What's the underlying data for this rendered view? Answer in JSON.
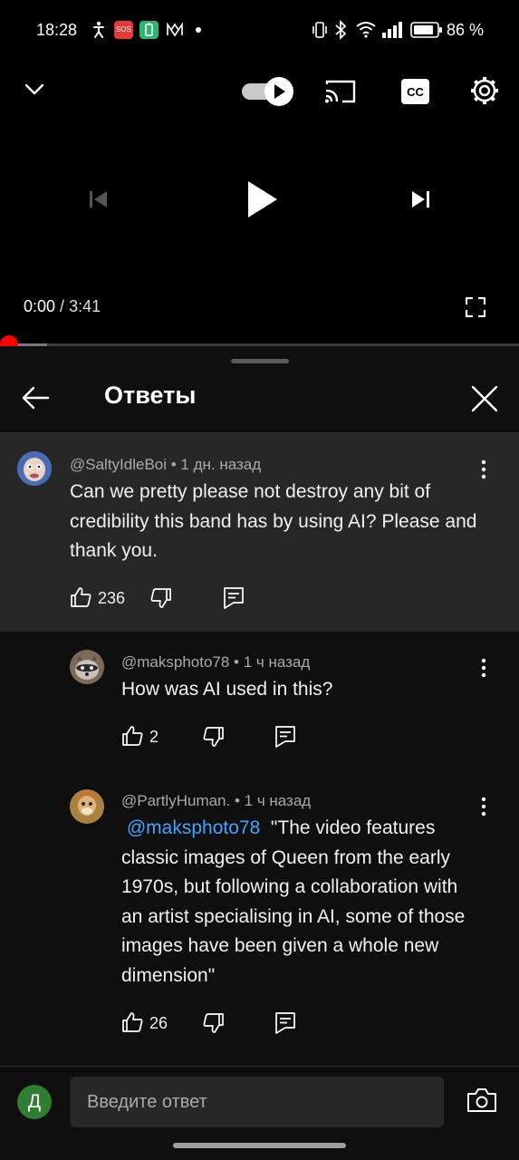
{
  "status_bar": {
    "time": "18:28",
    "battery": "86 %",
    "left_icons": [
      "accessibility-icon",
      "sos-icon",
      "battery-saver-icon",
      "network-icon",
      "dot-icon"
    ],
    "right_icons": [
      "vibrate-icon",
      "bluetooth-icon",
      "wifi-icon",
      "signal-icon",
      "battery-icon"
    ]
  },
  "player": {
    "current_time": "0:00",
    "separator": " / ",
    "duration": "3:41",
    "progress_fraction": 0.0,
    "autoplay_on": true,
    "controls": [
      "collapse-icon",
      "autoplay-toggle",
      "cast-icon",
      "captions-icon",
      "settings-icon",
      "previous-icon",
      "play-icon",
      "next-icon",
      "fullscreen-icon"
    ]
  },
  "panel": {
    "title": "Ответы"
  },
  "comments": [
    {
      "author": "@SaltyIdleBoi",
      "meta": " • 1 дн. назад",
      "text": "Can we pretty please not destroy any bit of credibility this band has by using AI? Please and thank you.",
      "likes": "236",
      "highlighted": true
    },
    {
      "author": "@maksphoto78",
      "meta": " • 1 ч назад",
      "text": "How was AI used in this?",
      "likes": "2",
      "highlighted": false
    },
    {
      "author": "@PartlyHuman.",
      "meta": " • 1 ч назад",
      "mention": "@maksphoto78",
      "text": "\"The video features classic images of Queen from the early 1970s, but following a collaboration with an artist specialising in AI, some of those images have been given a whole new dimension\"",
      "likes": "26",
      "highlighted": false
    }
  ],
  "reply_bar": {
    "user_initial": "Д",
    "placeholder": "Введите ответ"
  },
  "colors": {
    "accent_red": "#ff0000",
    "mention_blue": "#3ea6ff",
    "user_avatar": "#2e7d32"
  }
}
